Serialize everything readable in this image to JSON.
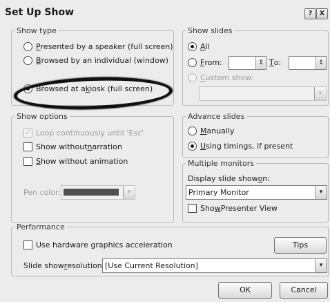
{
  "dialog": {
    "title": "Set Up Show",
    "help_glyph": "?",
    "close_glyph": "X"
  },
  "show_type": {
    "title": "Show type",
    "options": [
      {
        "pre": "",
        "key": "P",
        "post": "resented by a speaker (full screen)",
        "selected": false
      },
      {
        "pre": "",
        "key": "B",
        "post": "rowsed by an individual (window)",
        "selected": false
      },
      {
        "pre": "Browsed at a ",
        "key": "k",
        "post": "iosk (full screen)",
        "selected": true
      }
    ]
  },
  "show_slides": {
    "title": "Show slides",
    "all": {
      "pre": "",
      "key": "A",
      "post": "ll",
      "selected": true
    },
    "from": {
      "pre": "",
      "key": "F",
      "post": "rom:",
      "value": ""
    },
    "to": {
      "pre": "",
      "key": "T",
      "post": "o:",
      "value": ""
    },
    "custom": {
      "pre": "",
      "key": "C",
      "post": "ustom show:",
      "value": "",
      "disabled": true
    }
  },
  "show_options": {
    "title": "Show options",
    "loop": {
      "label": "Loop continuously until 'Esc'",
      "checked": true,
      "disabled": true
    },
    "narration": {
      "pre": "Show without ",
      "key": "n",
      "post": "arration",
      "checked": false
    },
    "animation": {
      "pre": "",
      "key": "S",
      "post": "how without animation",
      "checked": false
    },
    "pen_color_label": "Pen color:",
    "pen_color": "#505050"
  },
  "advance": {
    "title": "Advance slides",
    "manually": {
      "pre": "",
      "key": "M",
      "post": "anually",
      "selected": false
    },
    "timings": {
      "pre": "",
      "key": "U",
      "post": "sing timings, if present",
      "selected": true
    }
  },
  "monitors": {
    "title": "Multiple monitors",
    "display_label": {
      "pre": "Display slide show ",
      "key": "o",
      "post": "n:"
    },
    "display_value": "Primary Monitor",
    "presenter": {
      "pre": "Sho",
      "key": "w",
      "post": " Presenter View",
      "checked": false
    }
  },
  "performance": {
    "title": "Performance",
    "hw_accel": {
      "label": "Use hardware graphics acceleration",
      "checked": false
    },
    "tips_label": "Tips",
    "resolution_label": {
      "pre": "Slide show ",
      "key": "r",
      "post": "esolution:"
    },
    "resolution_value": "[Use Current Resolution]"
  },
  "buttons": {
    "ok": "OK",
    "cancel": "Cancel"
  },
  "glyphs": {
    "spin": "⇕",
    "dropdown": "▾",
    "check": "✓"
  }
}
